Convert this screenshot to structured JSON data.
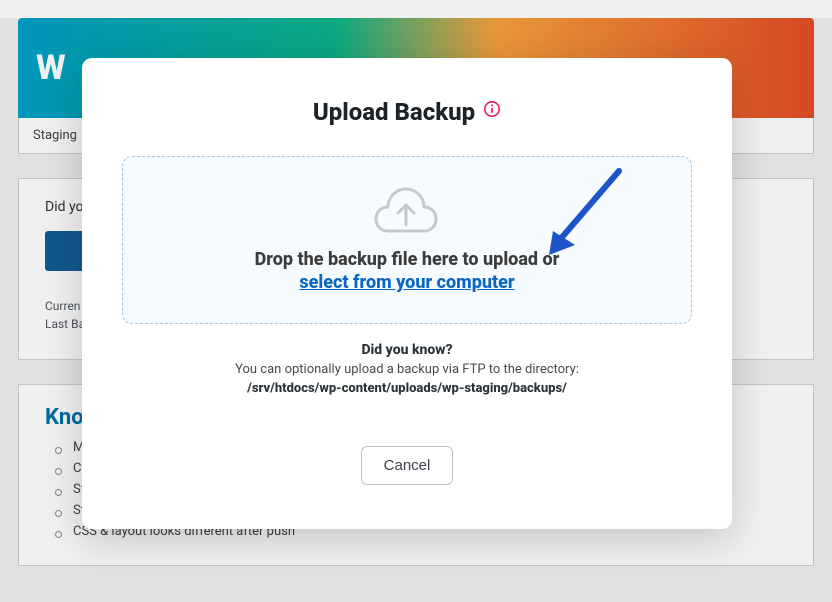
{
  "header": {
    "title": "W"
  },
  "tabs": {
    "label": "Staging"
  },
  "status_panel": {
    "prompt": "Did yo",
    "current_label": "Curren",
    "last_label": "Last Ba"
  },
  "kb": {
    "title": "Kno",
    "items": [
      "Mig",
      "Can",
      "Staging site redirects to production site",
      "Staging site returns blank white page",
      "CSS & layout looks different after push"
    ]
  },
  "modal": {
    "title": "Upload Backup",
    "drop_text": "Drop the backup file here to upload or",
    "select_text": "select from your computer",
    "did_you_know": "Did you know?",
    "tip_text": "You can optionally upload a backup via FTP to the directory:",
    "tip_path": "/srv/htdocs/wp-content/uploads/wp-staging/backups/",
    "cancel": "Cancel"
  }
}
